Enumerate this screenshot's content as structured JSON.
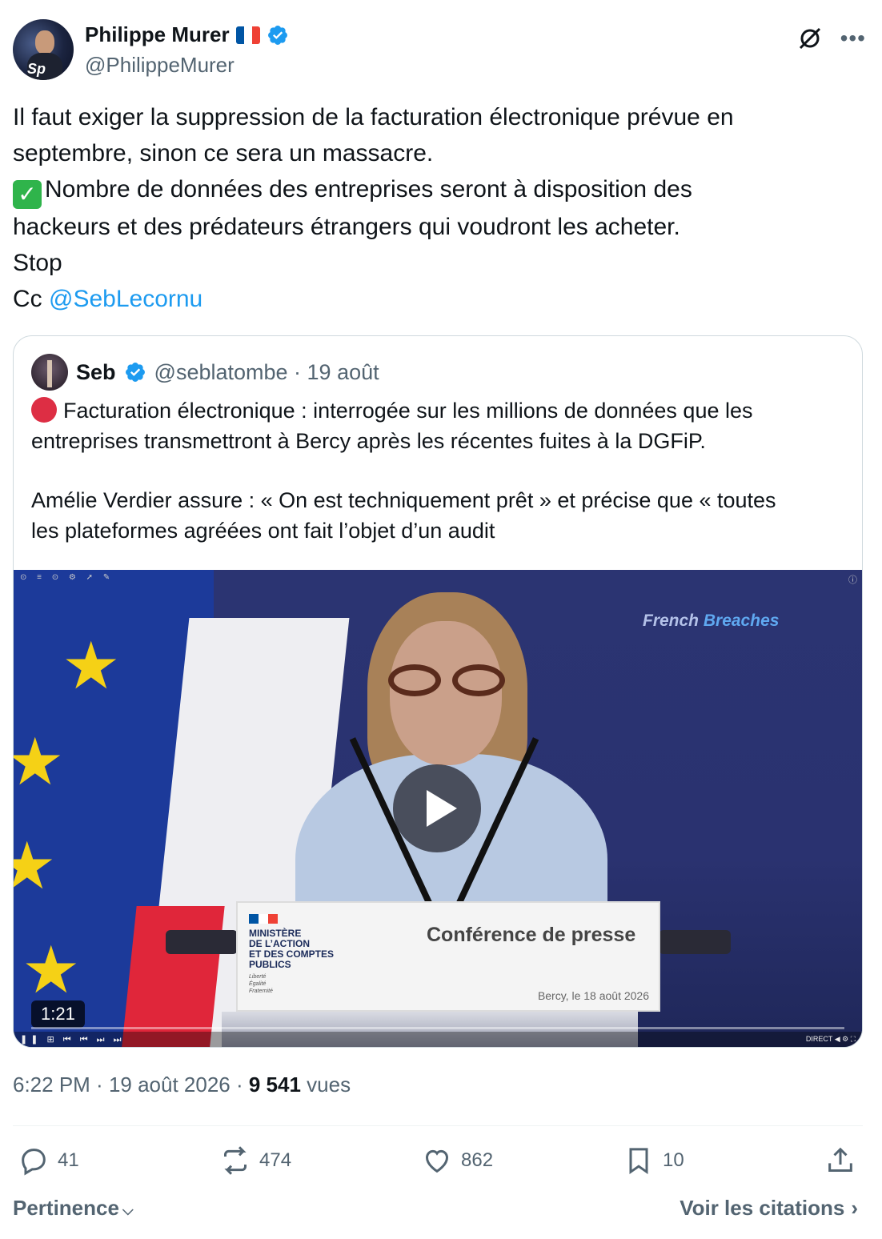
{
  "author": {
    "name": "Philippe Murer",
    "handle": "@PhilippeMurer",
    "avatar_icon": "profile-photo",
    "flag": "france-flag-emoji",
    "verified": true
  },
  "header_icons": [
    "grok-icon",
    "more-icon"
  ],
  "tweet": {
    "line1": "Il faut exiger la suppression de la facturation électronique prévue en",
    "line2": "septembre, sinon ce sera un massacre.",
    "line3": "Nombre de données des entreprises seront à disposition des",
    "line4": "hackeurs et des prédateurs étrangers qui voudront les acheter.",
    "line5": "Stop",
    "line6_prefix": "Cc ",
    "mention": "@SebLecornu"
  },
  "quoted": {
    "name": "Seb",
    "handle": "@seblatombe",
    "separator": " · ",
    "date": "19 août",
    "para1_line1": "Facturation électronique : interrogée sur les millions de données que les",
    "para1_line2": "entreprises transmettront à Bercy après les récentes fuites à la DGFiP.",
    "para2_line1": "Amélie Verdier assure : « On est techniquement prêt » et précise que « toutes",
    "para2_line2": "les plateformes agréées ont fait l’objet d’un audit",
    "video": {
      "brand_prefix": "French ",
      "brand_suffix": "Breaches",
      "podium_ministry": [
        "MINISTÈRE",
        "DE L’ACTION",
        "ET DES COMPTES",
        "PUBLICS"
      ],
      "podium_motto": [
        "Liberté",
        "Égalité",
        "Fraternité"
      ],
      "podium_title": "Conférence de presse",
      "podium_date": "Bercy, le 18 août 2026",
      "duration": "1:21",
      "live_label": "DIRECT"
    }
  },
  "meta": {
    "time": "6:22 PM",
    "sep": " · ",
    "date": "19 août 2026",
    "sep2": " · ",
    "views": "9 541",
    "views_label": " vues"
  },
  "actions": {
    "replies": "41",
    "reposts": "474",
    "likes": "862",
    "bookmarks": "10"
  },
  "footer": {
    "sort_label": "Pertinence",
    "quotes_link": "Voir les citations"
  },
  "colors": {
    "text": "#0f1419",
    "secondary": "#536471",
    "link": "#1d9bf0",
    "border": "#cfd9de"
  }
}
